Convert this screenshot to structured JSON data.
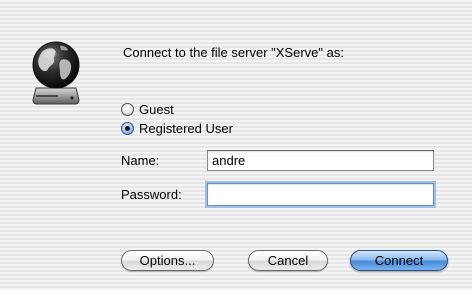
{
  "dialog": {
    "prompt": "Connect to the file server \"XServe\" as:",
    "icon": "file-server-globe-icon"
  },
  "login_type": {
    "options": [
      {
        "label": "Guest",
        "selected": false
      },
      {
        "label": "Registered User",
        "selected": true
      }
    ]
  },
  "fields": {
    "name_label": "Name:",
    "name_value": "andre",
    "password_label": "Password:",
    "password_value": ""
  },
  "buttons": {
    "options_label": "Options...",
    "cancel_label": "Cancel",
    "connect_label": "Connect"
  },
  "colors": {
    "accent": "#4c8ad8",
    "focus_ring": "#9fbde6"
  }
}
